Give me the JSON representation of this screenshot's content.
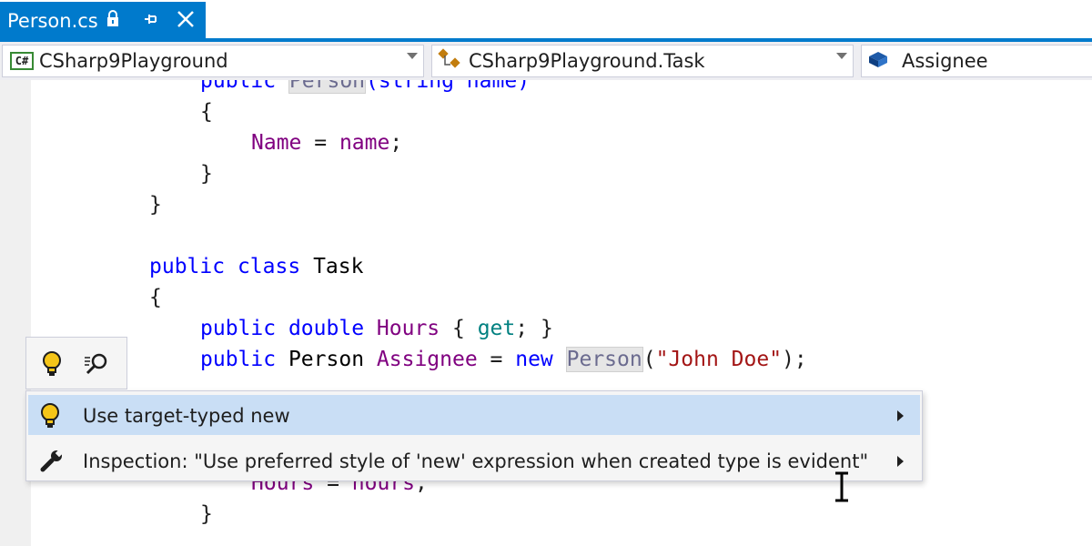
{
  "tab": {
    "title": "Person.cs"
  },
  "navbar": {
    "project": "CSharp9Playground",
    "project_icon": "C#",
    "type": "CSharp9Playground.Task",
    "member": "Assignee"
  },
  "code": {
    "line0": {
      "kw": "public ",
      "cls": "Person",
      "rest": "(string name)"
    },
    "line1": "{",
    "line2": {
      "id": "Name",
      "op": " = ",
      "val": "name",
      "end": ";"
    },
    "line3": "}",
    "line4": "}",
    "line5": {
      "kw1": "public",
      "sp1": " ",
      "kw2": "class",
      "sp2": " ",
      "name": "Task"
    },
    "line6": "{",
    "line7": {
      "kw1": "public",
      "sp1": " ",
      "kw2": "double",
      "sp2": " ",
      "prop": "Hours",
      "br1": " { ",
      "acc": "get",
      "br2": "; }"
    },
    "line8": {
      "kw": "public",
      "sp1": " ",
      "type": "Person",
      "sp2": " ",
      "field": "Assignee",
      "op": " = ",
      "newkw": "new",
      "sp3": " ",
      "ctor": "Person",
      "p1": "(",
      "str": "\"John Doe\"",
      "p2": ");"
    },
    "line9": {
      "a": "Hours",
      "b": " = ",
      "c": "hours",
      "d": ";"
    },
    "line10": "}"
  },
  "menu": {
    "items": [
      {
        "label": "Use target-typed new",
        "icon": "lightbulb-icon"
      },
      {
        "label": "Inspection: \"Use preferred style of 'new' expression when created type is evident\"",
        "icon": "wrench-icon"
      }
    ]
  }
}
